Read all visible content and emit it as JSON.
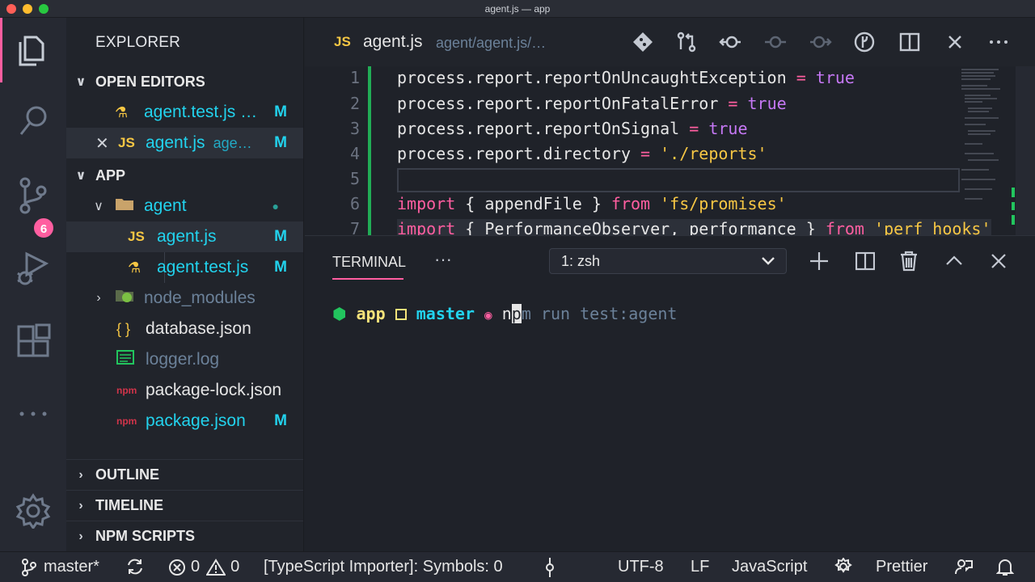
{
  "window": {
    "title": "agent.js — app"
  },
  "colors": {
    "accent": "#ff5ea0",
    "cyan": "#22d3ee",
    "yellow": "#f7c744",
    "green": "#22c55e",
    "purple": "#c678f5"
  },
  "activity_bar": {
    "items": [
      "explorer-icon",
      "search-icon",
      "source-control-icon",
      "run-debug-icon",
      "extensions-icon",
      "more-icon",
      "settings-gear-icon"
    ],
    "scm_badge": "6"
  },
  "sidebar": {
    "title": "EXPLORER",
    "open_editors": {
      "label": "OPEN EDITORS",
      "items": [
        {
          "icon": "test-file-icon",
          "name": "agent.test.js …",
          "status": "M"
        },
        {
          "icon": "js-file-icon",
          "close": "✕",
          "name": "agent.js",
          "path": "age…",
          "status": "M"
        }
      ]
    },
    "app": {
      "label": "APP",
      "folder": {
        "name": "agent",
        "dot": "●"
      },
      "children": [
        {
          "icon_label": "JS",
          "name": "agent.js",
          "status": "M"
        },
        {
          "icon": "test-file-icon",
          "name": "agent.test.js",
          "status": "M"
        }
      ],
      "files": [
        {
          "icon": "node-folder-icon",
          "name": "node_modules"
        },
        {
          "icon_label": "{ }",
          "name": "database.json"
        },
        {
          "icon": "log-file-icon",
          "name": "logger.log"
        },
        {
          "icon_label": "npm",
          "name": "package-lock.json"
        },
        {
          "icon_label": "npm",
          "name": "package.json",
          "status": "M"
        }
      ]
    },
    "outline_label": "OUTLINE",
    "timeline_label": "TIMELINE",
    "npm_scripts_label": "NPM SCRIPTS"
  },
  "editor": {
    "tab": {
      "icon_label": "JS",
      "name": "agent.js",
      "path": "agent/agent.js/…"
    },
    "toolbar": [
      "git-icon",
      "compare-changes-icon",
      "previous-change-icon",
      "commit-dot-icon",
      "next-change-icon",
      "git-graph-icon",
      "split-editor-icon",
      "close-icon",
      "more-actions-icon"
    ],
    "lines": [
      {
        "n": "1",
        "a": "process.report.reportOnUncaughtException ",
        "op": "=",
        "b": " ",
        "v": "true"
      },
      {
        "n": "2",
        "a": "process.report.reportOnFatalError ",
        "op": "=",
        "b": " ",
        "v": "true"
      },
      {
        "n": "3",
        "a": "process.report.reportOnSignal ",
        "op": "=",
        "b": " ",
        "v": "true"
      },
      {
        "n": "4",
        "a": "process.report.directory ",
        "op": "=",
        "b": " ",
        "s": "'./reports'"
      },
      {
        "n": "5"
      },
      {
        "n": "6",
        "kw": "import",
        "a": " { appendFile } ",
        "kw2": "from",
        "s": " 'fs/promises'"
      },
      {
        "n": "7",
        "kw": "import",
        "a": " { PerformanceObserver, performance } ",
        "kw2": "from",
        "s": " 'perf_hooks'"
      }
    ]
  },
  "terminal": {
    "tab_label": "TERMINAL",
    "more": "···",
    "shell_select": "1: zsh",
    "actions": [
      "new-terminal-icon",
      "split-terminal-icon",
      "kill-terminal-icon",
      "maximize-panel-icon",
      "close-panel-icon"
    ],
    "prompt": {
      "dir_icon": "⬢",
      "dir": "app",
      "branch_icon": "",
      "branch": "master",
      "status_icon": "◉",
      "typed_1": "n",
      "cursor": "p",
      "typed_2": "m",
      "suggestion": " run test:agent"
    }
  },
  "status_bar": {
    "branch": "master*",
    "errors": "0",
    "warnings": "0",
    "message": "[TypeScript Importer]: Symbols: 0",
    "encoding": "UTF-8",
    "eol": "LF",
    "language": "JavaScript",
    "formatter": "Prettier"
  }
}
